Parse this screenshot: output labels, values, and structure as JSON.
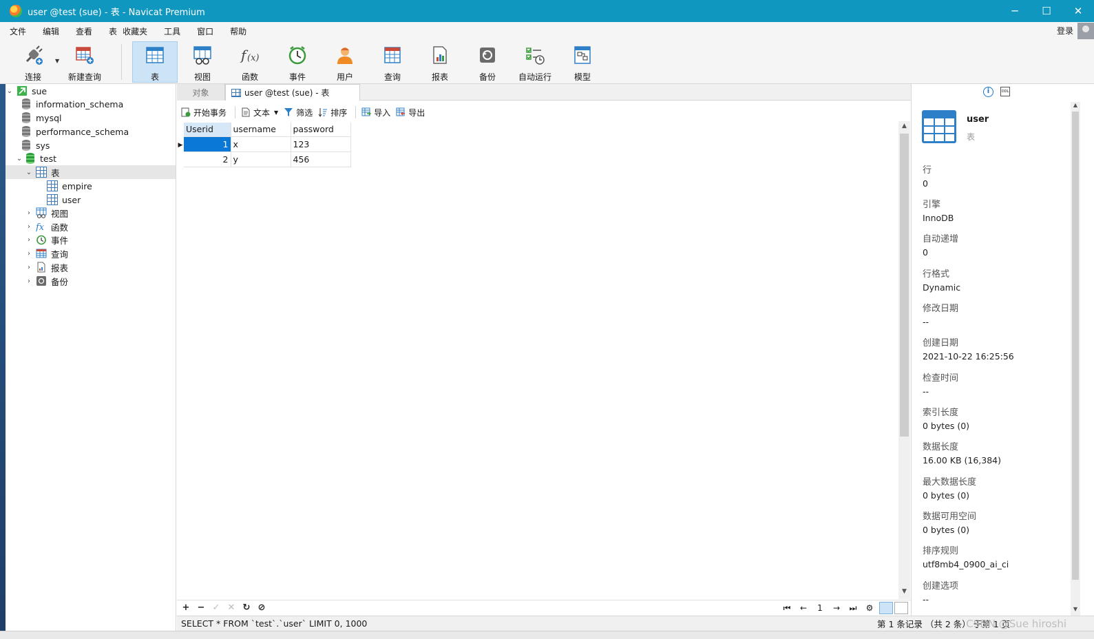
{
  "window": {
    "title": "user @test (sue) - 表 - Navicat Premium",
    "controls": [
      "─",
      "☐",
      "✕"
    ]
  },
  "menu": [
    "文件",
    "编辑",
    "查看",
    "表",
    "收藏夹",
    "工具",
    "窗口",
    "帮助"
  ],
  "login_label": "登录",
  "toolbar": [
    {
      "label": "连接",
      "icon": "plug-icon"
    },
    {
      "label": "新建查询",
      "icon": "new-query-icon"
    },
    {
      "label": "表",
      "icon": "table-icon"
    },
    {
      "label": "视图",
      "icon": "view-icon"
    },
    {
      "label": "函数",
      "icon": "function-icon"
    },
    {
      "label": "事件",
      "icon": "clock-icon"
    },
    {
      "label": "用户",
      "icon": "user-icon"
    },
    {
      "label": "查询",
      "icon": "query-icon"
    },
    {
      "label": "报表",
      "icon": "report-icon"
    },
    {
      "label": "备份",
      "icon": "backup-icon"
    },
    {
      "label": "自动运行",
      "icon": "automation-icon"
    },
    {
      "label": "模型",
      "icon": "model-icon"
    }
  ],
  "tree": {
    "connection": "sue",
    "databases": [
      "information_schema",
      "mysql",
      "performance_schema",
      "sys"
    ],
    "open_db": "test",
    "tables_folder": "表",
    "tables": [
      "empire",
      "user"
    ],
    "folders": [
      "视图",
      "函数",
      "事件",
      "查询",
      "报表",
      "备份"
    ]
  },
  "tabs": {
    "objects": "对象",
    "active": "user @test (sue) - 表"
  },
  "subtoolbar": {
    "begin_tx": "开始事务",
    "text": "文本",
    "filter": "筛选",
    "sort": "排序",
    "import": "导入",
    "export": "导出"
  },
  "grid": {
    "columns": [
      "Userid",
      "username",
      "password"
    ],
    "rows": [
      [
        "1",
        "x",
        "123"
      ],
      [
        "2",
        "y",
        "456"
      ]
    ]
  },
  "bottom": {
    "page": "1"
  },
  "status": {
    "sql": "SELECT * FROM `test`.`user` LIMIT 0, 1000",
    "records": "第 1 条记录 （共 2 条） 于第 1 页",
    "watermark": "CSDN @Sue hiroshi"
  },
  "info": {
    "name": "user",
    "type": "表",
    "props": [
      {
        "k": "行",
        "v": "0"
      },
      {
        "k": "引擎",
        "v": "InnoDB"
      },
      {
        "k": "自动递增",
        "v": "0"
      },
      {
        "k": "行格式",
        "v": "Dynamic"
      },
      {
        "k": "修改日期",
        "v": "--"
      },
      {
        "k": "创建日期",
        "v": "2021-10-22 16:25:56"
      },
      {
        "k": "检查时间",
        "v": "--"
      },
      {
        "k": "索引长度",
        "v": "0 bytes (0)"
      },
      {
        "k": "数据长度",
        "v": "16.00 KB (16,384)"
      },
      {
        "k": "最大数据长度",
        "v": "0 bytes (0)"
      },
      {
        "k": "数据可用空间",
        "v": "0 bytes (0)"
      },
      {
        "k": "排序规则",
        "v": "utf8mb4_0900_ai_ci"
      },
      {
        "k": "创建选项",
        "v": "--"
      }
    ]
  },
  "colors": {
    "titlebar": "#0f97bf",
    "selection": "#0a78d7",
    "active_tool": "#cde4f7"
  }
}
